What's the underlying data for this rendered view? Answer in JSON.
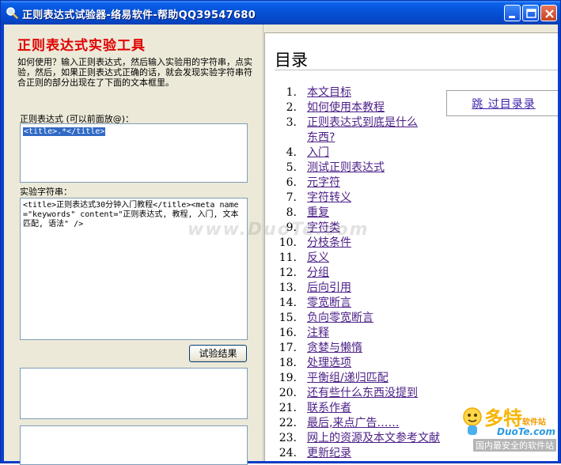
{
  "window": {
    "title": "正则表达式试验器-络易软件-帮助QQ39547680",
    "icon": "magnifier-icon"
  },
  "left": {
    "heading": "正则表达式实验工具",
    "intro": "如何使用？输入正则表达式，然后输入实验用的字符串，点实验，然后，如果正则表达式正确的话，就会发现实验字符串符合正则的部分出现在了下面的文本框里。",
    "regex_label": "正则表达式 (可以前面放@)：",
    "regex_value": "<title>.*</title>",
    "test_label": "实验字符串：",
    "test_value": "<title>正则表达式30分钟入门教程</title><meta name=\"keywords\" content=\"正则表达式, 教程, 入门, 文本匹配, 语法\" />",
    "run_button": "试验结果",
    "result_1": "",
    "result_2": ""
  },
  "toc": {
    "title": "目录",
    "skip_link": "跳 过目录录",
    "items": [
      {
        "num": "1.",
        "label": "本文目标"
      },
      {
        "num": "2.",
        "label": "如何使用本教程"
      },
      {
        "num": "3.",
        "label": "正则表达式到底是什么东西?"
      },
      {
        "num": "4.",
        "label": "入门"
      },
      {
        "num": "5.",
        "label": "测试正则表达式"
      },
      {
        "num": "6.",
        "label": "元字符"
      },
      {
        "num": "7.",
        "label": "字符转义"
      },
      {
        "num": "8.",
        "label": "重复"
      },
      {
        "num": "9.",
        "label": "字符类"
      },
      {
        "num": "10.",
        "label": "分枝条件"
      },
      {
        "num": "11.",
        "label": "反义"
      },
      {
        "num": "12.",
        "label": "分组"
      },
      {
        "num": "13.",
        "label": "后向引用"
      },
      {
        "num": "14.",
        "label": "零宽断言"
      },
      {
        "num": "15.",
        "label": "负向零宽断言"
      },
      {
        "num": "16.",
        "label": "注释"
      },
      {
        "num": "17.",
        "label": "贪婪与懒惰"
      },
      {
        "num": "18.",
        "label": "处理选项"
      },
      {
        "num": "19.",
        "label": "平衡组/递归匹配"
      },
      {
        "num": "20.",
        "label": "还有些什么东西没提到"
      },
      {
        "num": "21.",
        "label": "联系作者"
      },
      {
        "num": "22.",
        "label": "最后,来点广告……"
      },
      {
        "num": "23.",
        "label": "网上的资源及本文参考文献"
      },
      {
        "num": "24.",
        "label": "更新纪录"
      }
    ]
  },
  "watermark": "www.DuoTe.com",
  "logo": {
    "brand": "多特",
    "brand_suffix": "软件站",
    "site": "DuoTe.com",
    "slogan": "国内最安全的软件站"
  }
}
